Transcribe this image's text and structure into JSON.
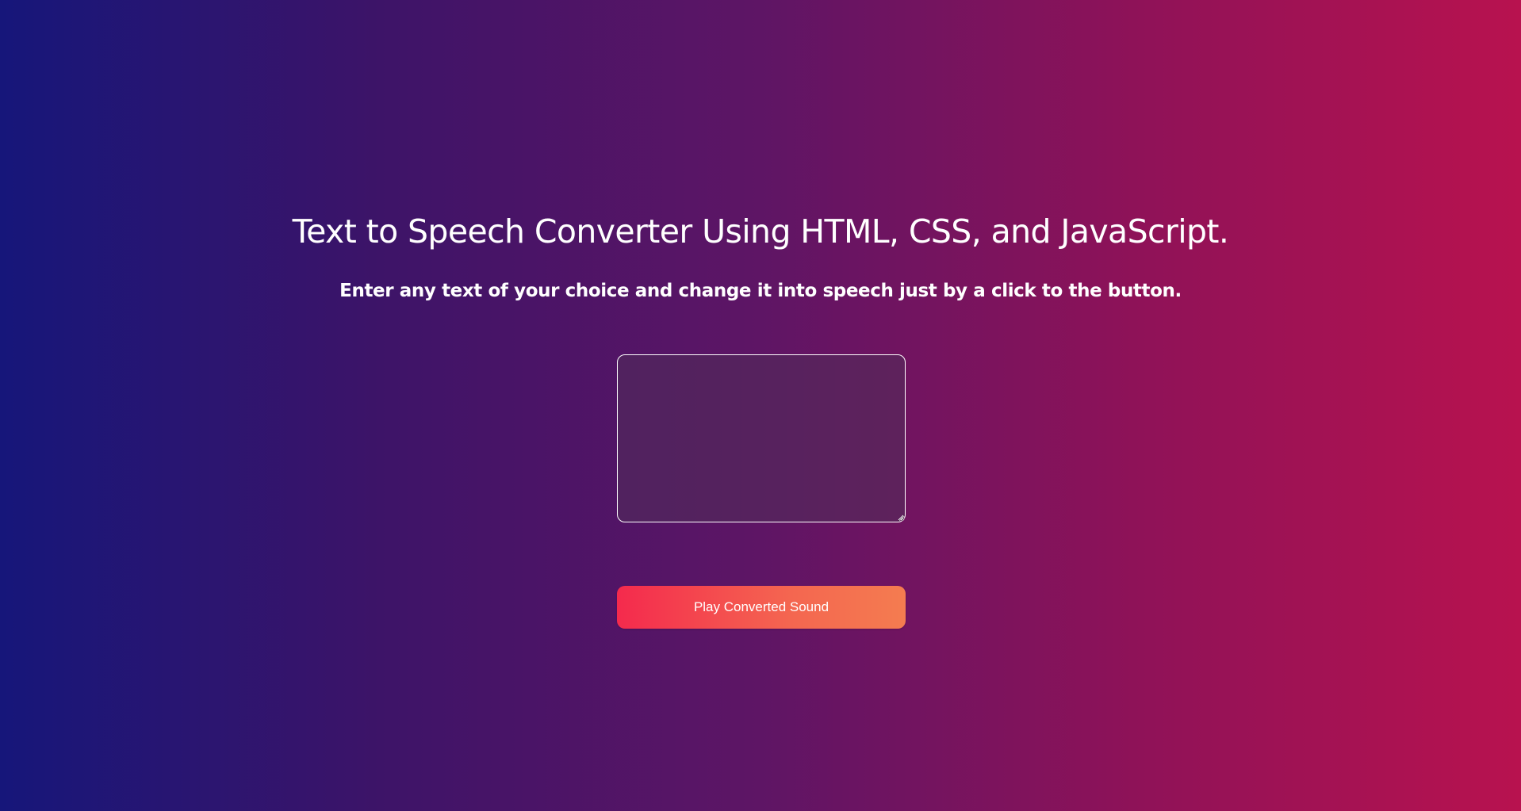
{
  "header": {
    "title": "Text to Speech Converter Using HTML, CSS, and JavaScript.",
    "subtitle": "Enter any text of your choice and change it into speech just by a click to the button."
  },
  "converter": {
    "text_input_value": "",
    "text_input_placeholder": "",
    "play_button_label": "Play Converted Sound"
  },
  "colors": {
    "background_left": "#16167a",
    "background_right": "#b8124f",
    "button_left": "#f42a4d",
    "button_right": "#f47c50",
    "text": "#ffffff"
  }
}
